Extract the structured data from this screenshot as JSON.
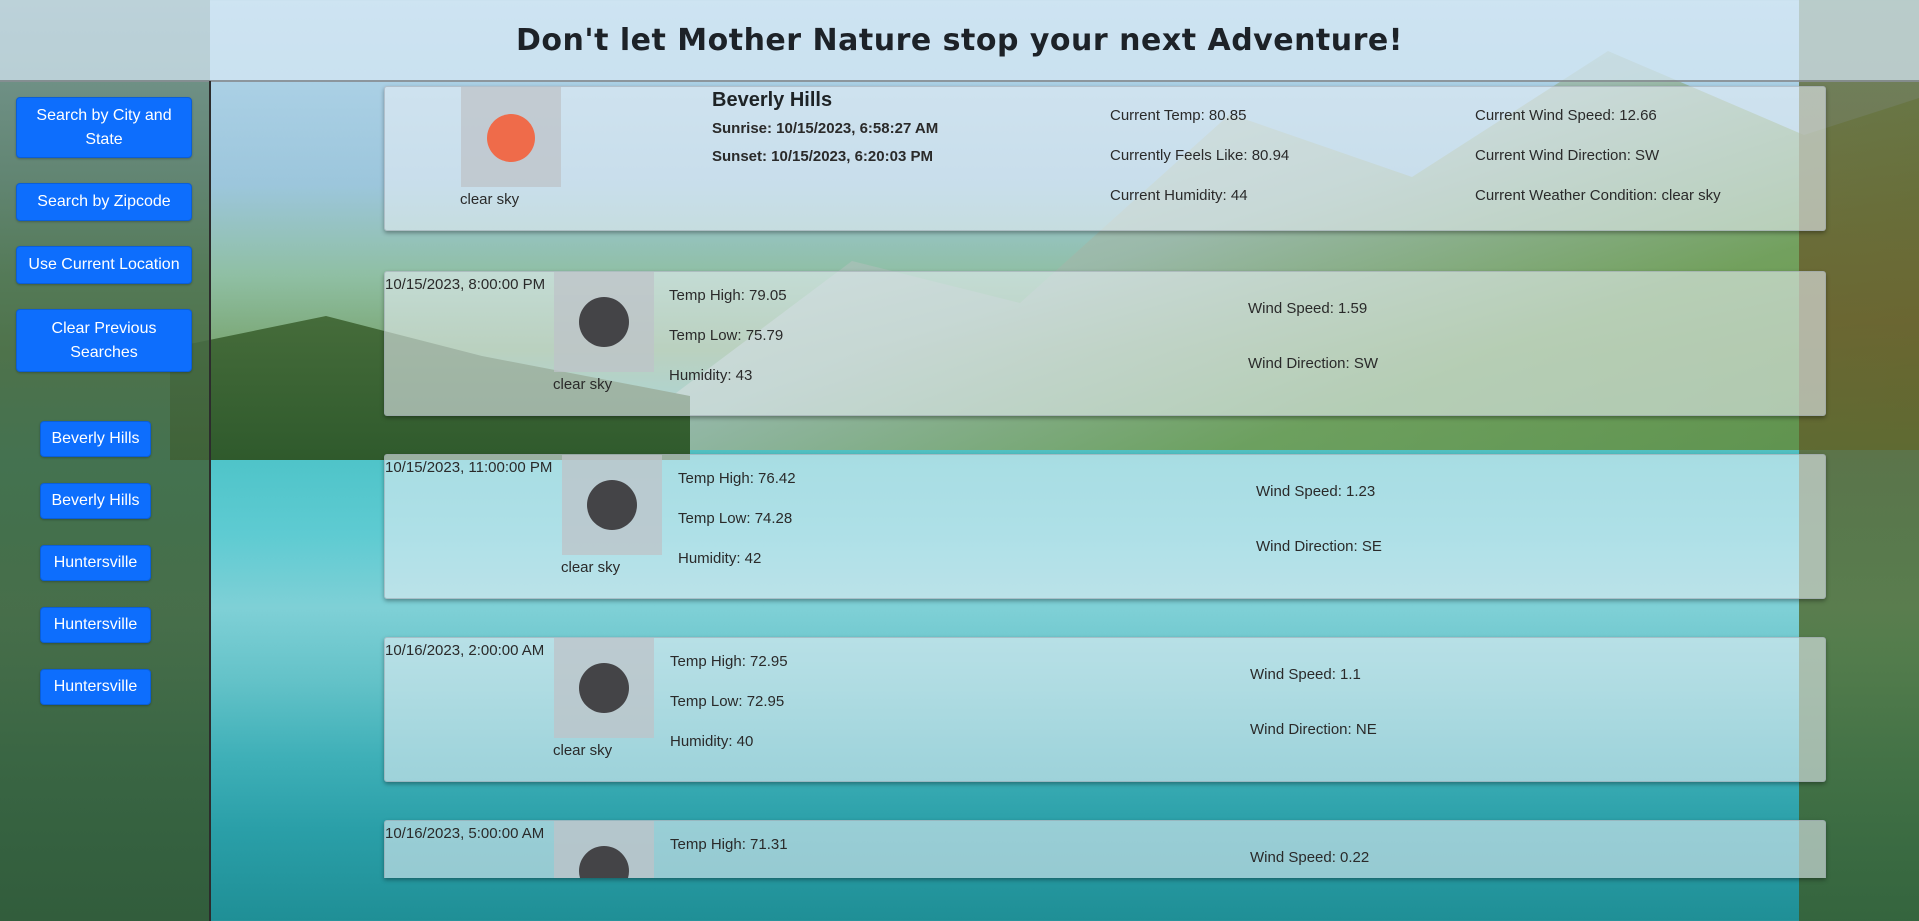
{
  "header": {
    "title": "Don't let Mother Nature stop your next Adventure!"
  },
  "sidebar": {
    "buttons": {
      "city_state": "Search by City and State",
      "zipcode": "Search by Zipcode",
      "current_location": "Use Current Location",
      "clear": "Clear Previous Searches"
    },
    "history": [
      "Beverly Hills",
      "Beverly Hills",
      "Huntersville",
      "Huntersville",
      "Huntersville"
    ]
  },
  "current": {
    "city": "Beverly Hills",
    "sunrise": "Sunrise: 10/15/2023, 6:58:27 AM",
    "sunset": "Sunset: 10/15/2023, 6:20:03 PM",
    "condition_label": "clear sky",
    "temp": "Current Temp: 80.85",
    "feels_like": "Currently Feels Like: 80.94",
    "humidity": "Current Humidity: 44",
    "wind_speed": "Current Wind Speed: 12.66",
    "wind_direction": "Current Wind Direction: SW",
    "weather_condition": "Current Weather Condition: clear sky",
    "icon": "sun-icon",
    "icon_color": "#ef6b4a"
  },
  "forecast": [
    {
      "datetime": "10/15/2023, 8:00:00 PM",
      "condition": "clear sky",
      "temp_high": "Temp High: 79.05",
      "temp_low": "Temp Low: 75.79",
      "humidity": "Humidity: 43",
      "wind_speed": "Wind Speed: 1.59",
      "wind_direction": "Wind Direction: SW"
    },
    {
      "datetime": "10/15/2023, 11:00:00 PM",
      "condition": "clear sky",
      "temp_high": "Temp High: 76.42",
      "temp_low": "Temp Low: 74.28",
      "humidity": "Humidity: 42",
      "wind_speed": "Wind Speed: 1.23",
      "wind_direction": "Wind Direction: SE"
    },
    {
      "datetime": "10/16/2023, 2:00:00 AM",
      "condition": "clear sky",
      "temp_high": "Temp High: 72.95",
      "temp_low": "Temp Low: 72.95",
      "humidity": "Humidity: 40",
      "wind_speed": "Wind Speed: 1.1",
      "wind_direction": "Wind Direction: NE"
    },
    {
      "datetime": "10/16/2023, 5:00:00 AM",
      "temp_high": "Temp High: 71.31",
      "wind_speed": "Wind Speed: 0.22"
    }
  ],
  "colors": {
    "button": "#0d6efd",
    "night_icon": "#444447"
  }
}
